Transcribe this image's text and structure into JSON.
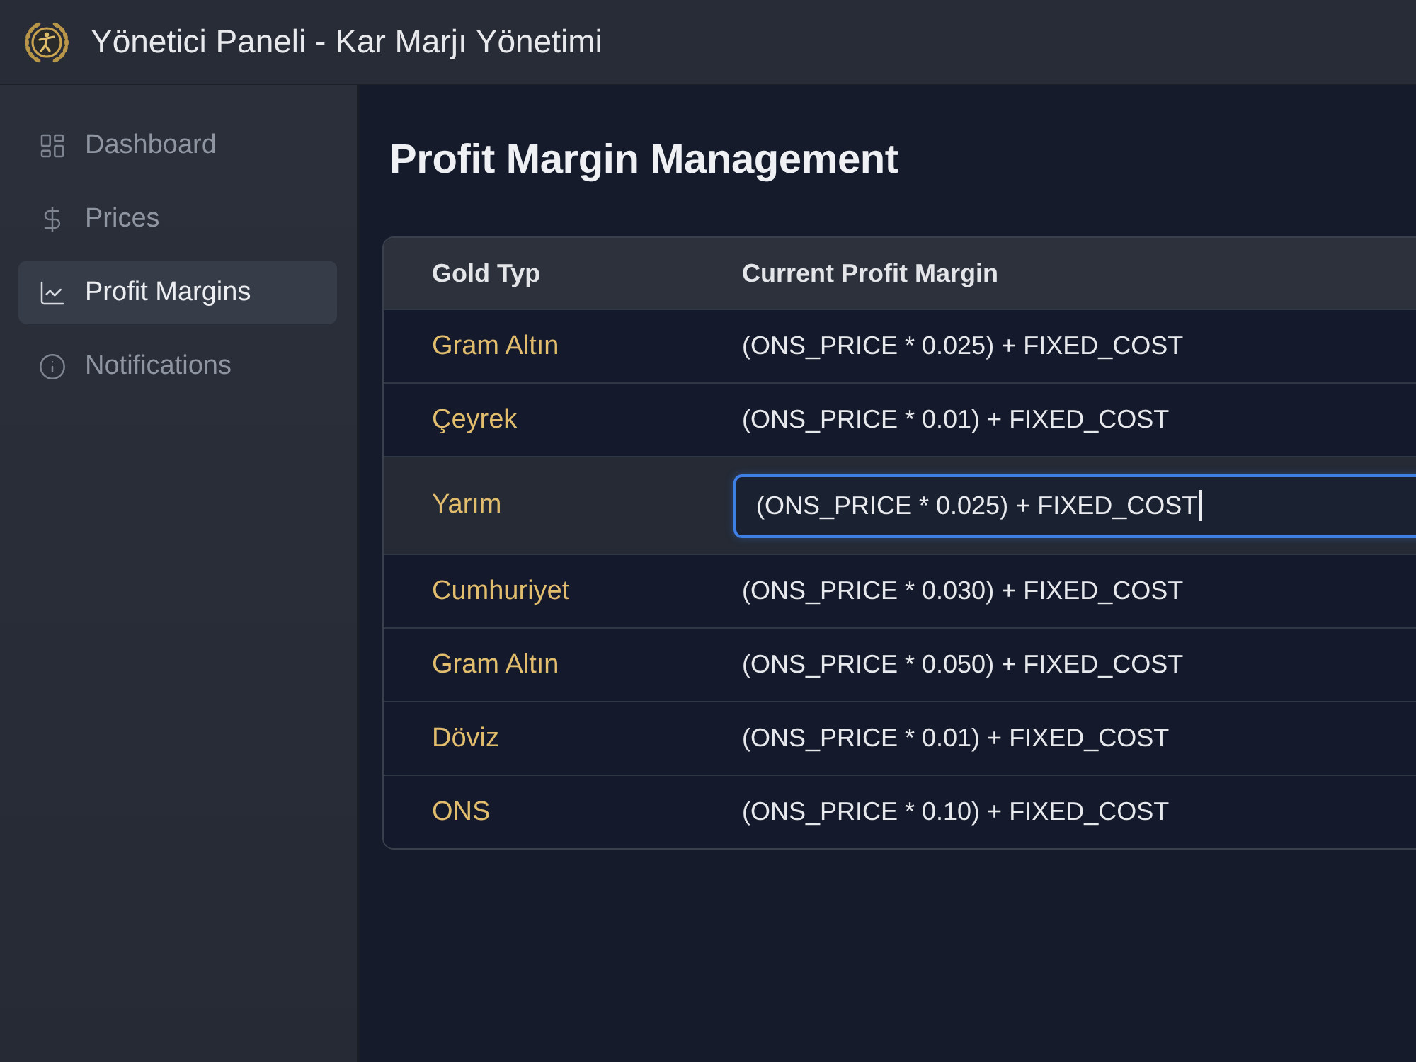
{
  "header": {
    "title": "Yönetici Paneli - Kar Marjı Yönetimi"
  },
  "sidebar": {
    "items": [
      {
        "label": "Dashboard",
        "selected": false
      },
      {
        "label": "Prices",
        "selected": false
      },
      {
        "label": "Profit Margins",
        "selected": true
      },
      {
        "label": "Notifications",
        "selected": false
      }
    ]
  },
  "page": {
    "title": "Profit Margin Management"
  },
  "table": {
    "columns": [
      "Gold Typ",
      "Current Profit Margin"
    ],
    "rows": [
      {
        "type": "Gram Altın",
        "margin": "(ONS_PRICE * 0.025) + FIXED_COST",
        "editing": false
      },
      {
        "type": "Çeyrek",
        "margin": "(ONS_PRICE * 0.01) + FIXED_COST",
        "editing": false
      },
      {
        "type": "Yarım",
        "margin": "(ONS_PRICE * 0.025) + FIXED_COST",
        "editing": true
      },
      {
        "type": "Cumhuriyet",
        "margin": "(ONS_PRICE * 0.030) + FIXED_COST",
        "editing": false
      },
      {
        "type": "Gram Altın",
        "margin": "(ONS_PRICE * 0.050) + FIXED_COST",
        "editing": false
      },
      {
        "type": "Döviz",
        "margin": "(ONS_PRICE * 0.01) + FIXED_COST",
        "editing": false
      },
      {
        "type": "ONS",
        "margin": "(ONS_PRICE * 0.10) + FIXED_COST",
        "editing": false
      }
    ]
  }
}
